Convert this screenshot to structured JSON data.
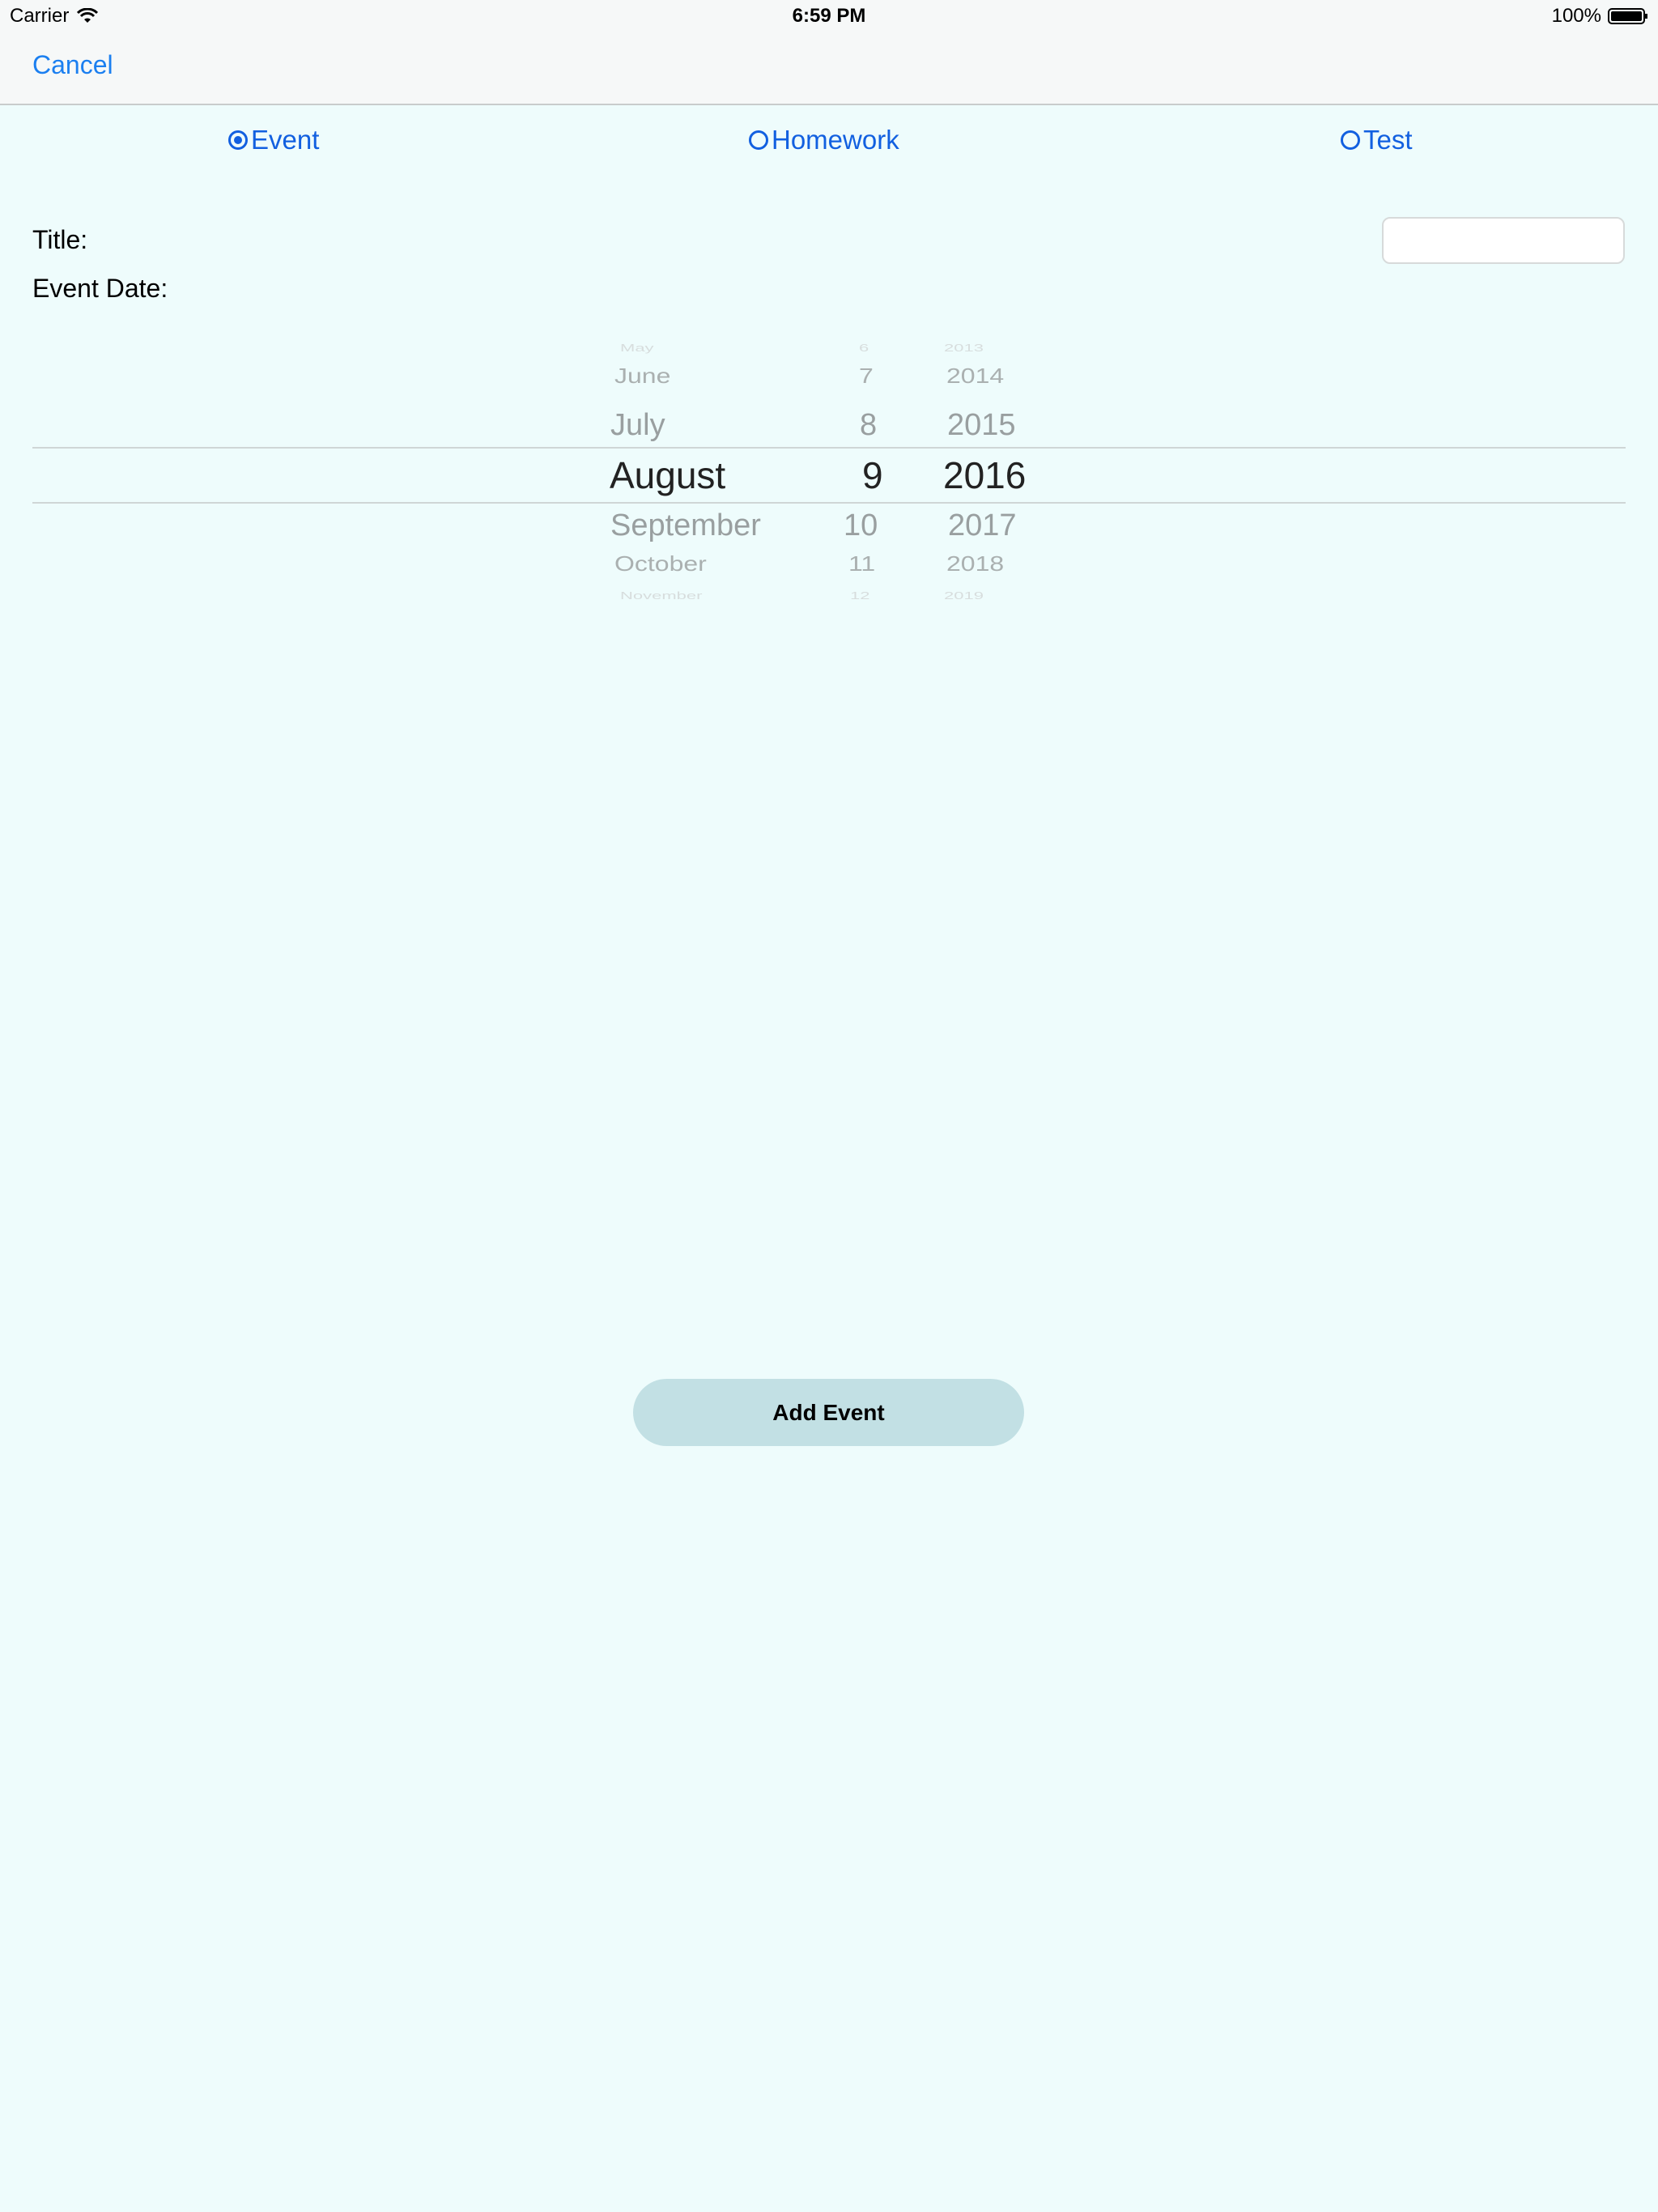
{
  "status_bar": {
    "carrier": "Carrier",
    "time": "6:59 PM",
    "battery": "100%"
  },
  "nav": {
    "cancel_label": "Cancel"
  },
  "type_options": [
    {
      "label": "Event",
      "selected": true
    },
    {
      "label": "Homework",
      "selected": false
    },
    {
      "label": "Test",
      "selected": false
    }
  ],
  "form": {
    "title_label": "Title:",
    "title_value": "",
    "date_label": "Event Date:"
  },
  "date_picker": {
    "months": [
      "May",
      "June",
      "July",
      "August",
      "September",
      "October",
      "November"
    ],
    "days": [
      "6",
      "7",
      "8",
      "9",
      "10",
      "11",
      "12"
    ],
    "years": [
      "2013",
      "2014",
      "2015",
      "2016",
      "2017",
      "2018",
      "2019"
    ],
    "selected": {
      "month": "August",
      "day": "9",
      "year": "2016"
    }
  },
  "actions": {
    "add_label": "Add Event"
  },
  "colors": {
    "accent": "#1260e0",
    "link": "#1b7ff0",
    "background": "#eefcfc",
    "button": "#c2e0e4"
  }
}
